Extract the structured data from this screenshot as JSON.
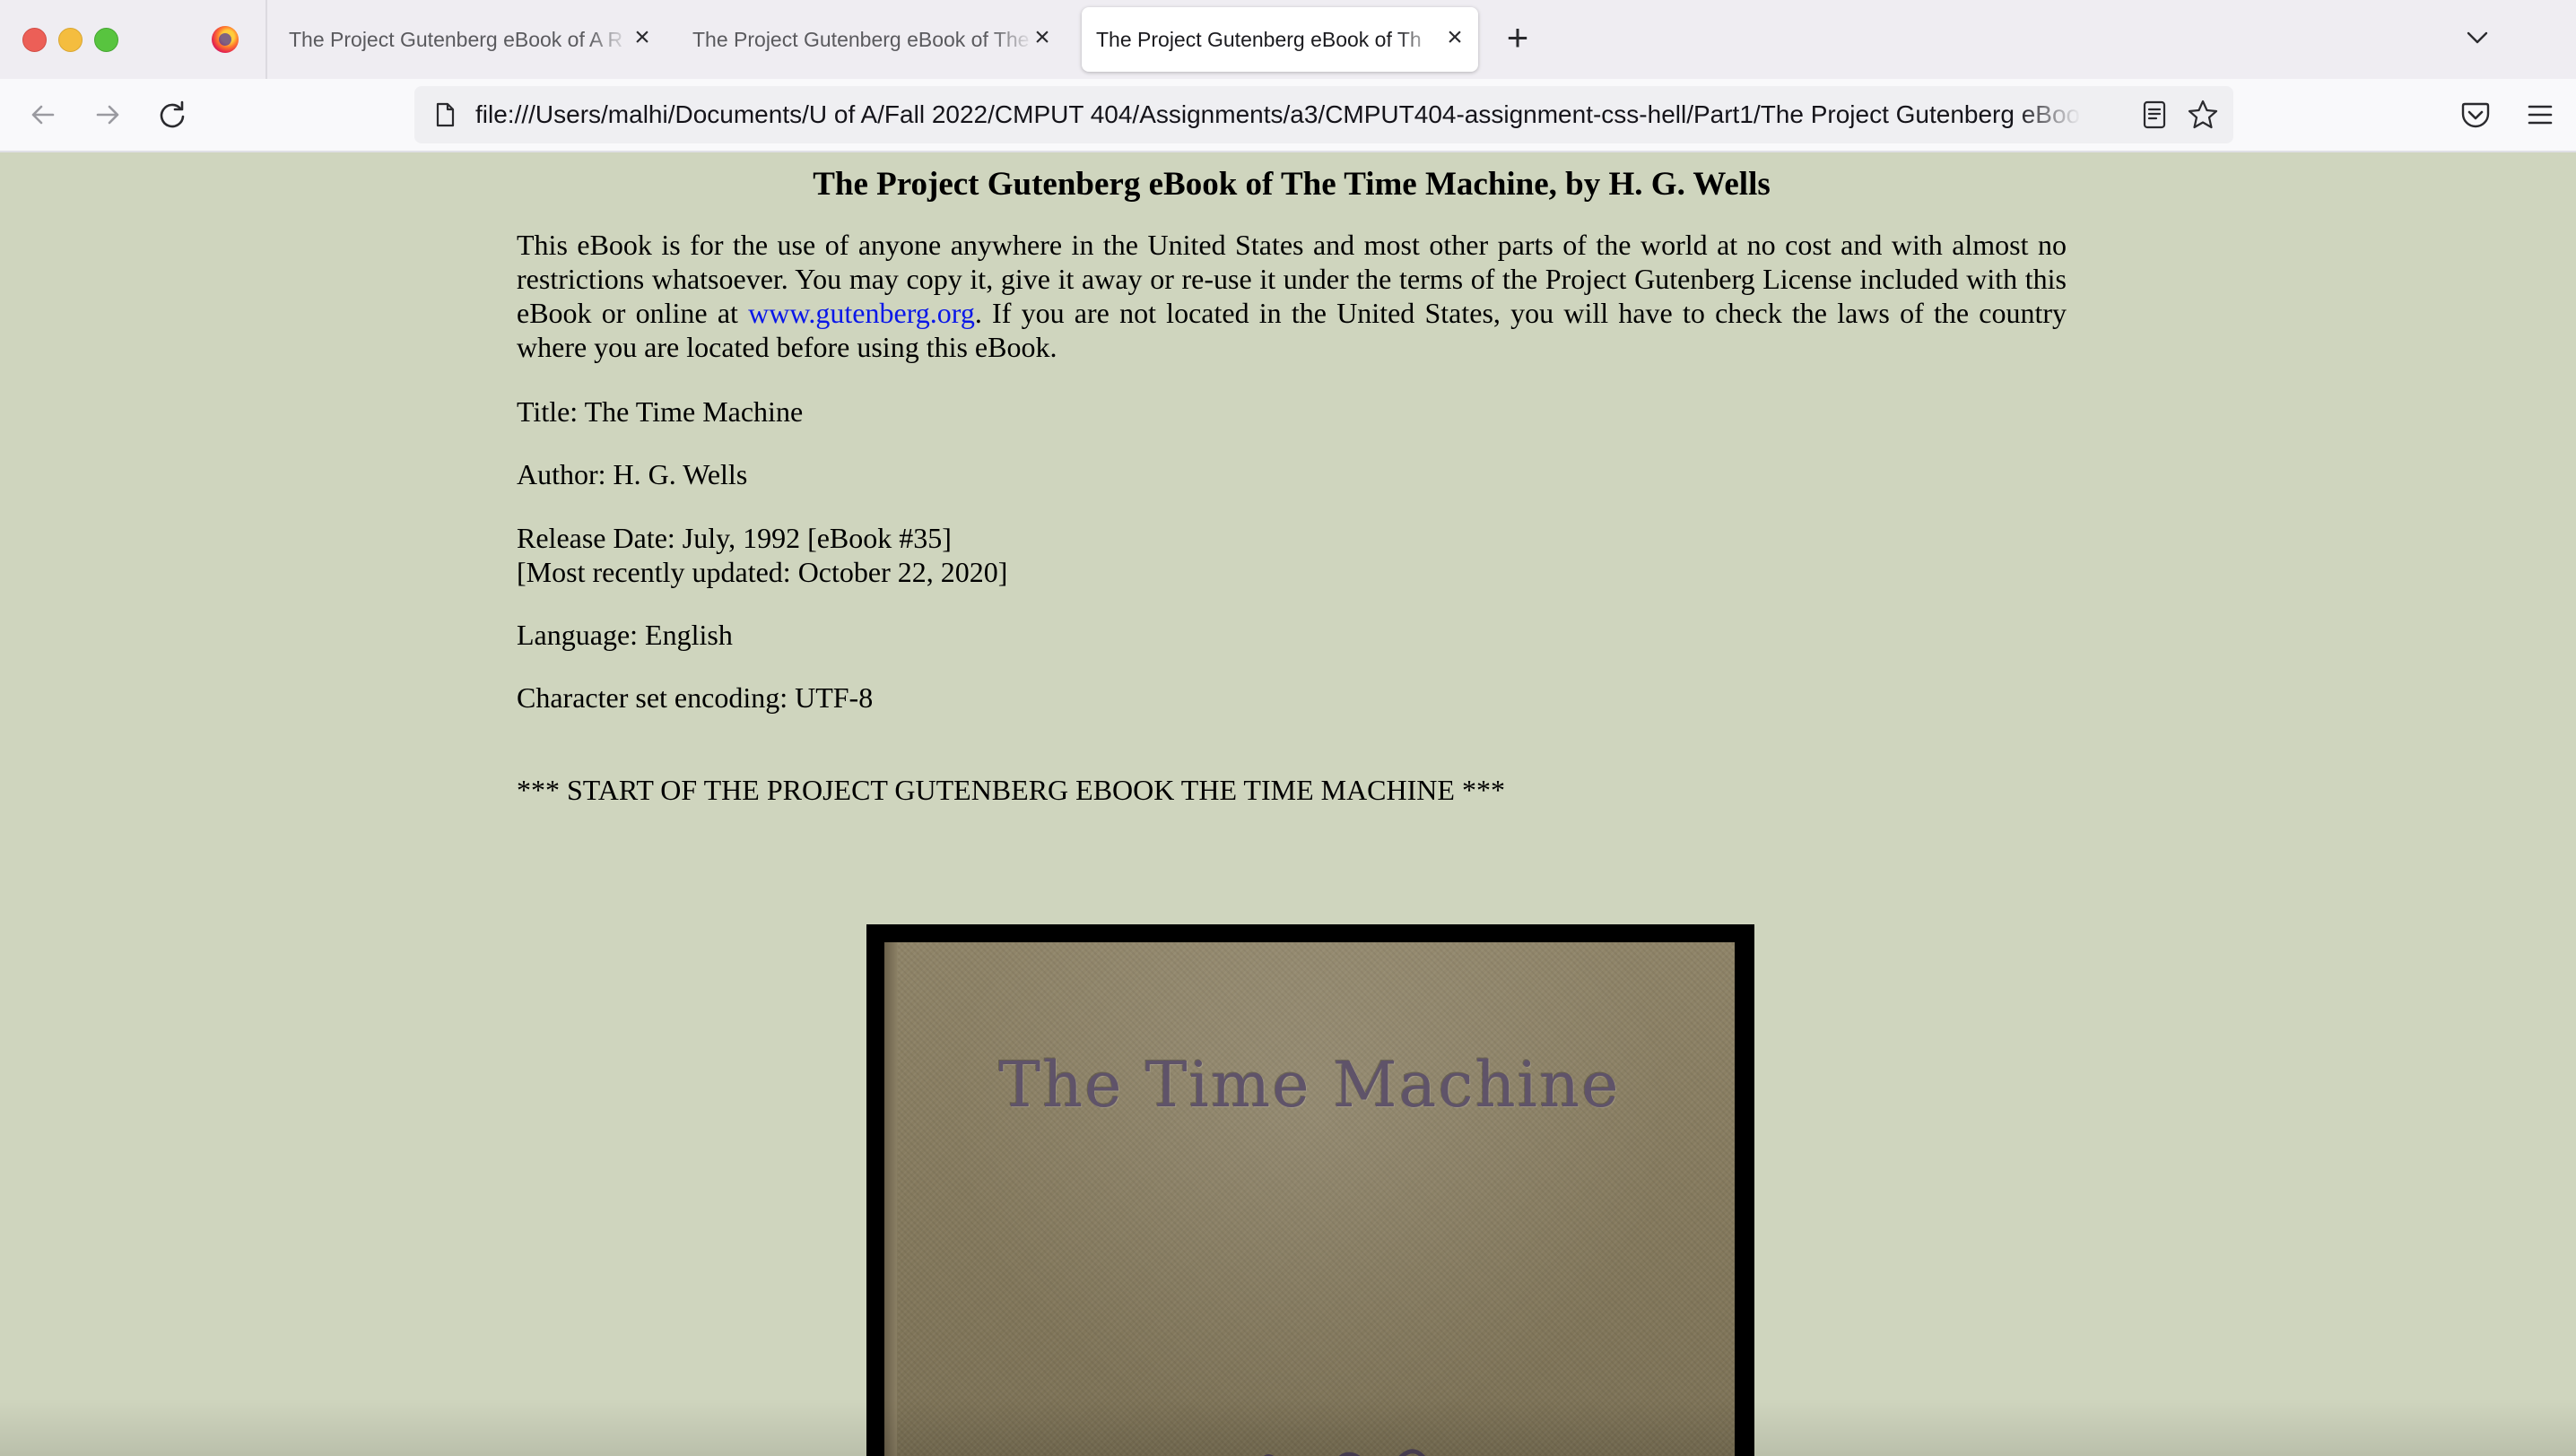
{
  "window": {
    "controls": {
      "close_color": "#ec5f57",
      "minimize_color": "#f4bd3f",
      "zoom_color": "#58c43f"
    }
  },
  "tabs": [
    {
      "title": "The Project Gutenberg eBook of A R",
      "active": false
    },
    {
      "title": "The Project Gutenberg eBook of The",
      "active": false
    },
    {
      "title": "The Project Gutenberg eBook of Th",
      "active": true
    }
  ],
  "icons": {
    "browser": "firefox-icon",
    "tab_close": "close-icon",
    "new_tab": "plus-icon",
    "tab_list": "chevron-down-icon",
    "back": "arrow-left-icon",
    "forward": "arrow-right-icon",
    "reload": "reload-icon",
    "page": "page-icon",
    "reader": "reader-view-icon",
    "bookmark": "star-icon",
    "pocket": "pocket-icon",
    "menu": "hamburger-menu-icon"
  },
  "toolbar": {
    "url": "file:///Users/malhi/Documents/U of A/Fall 2022/CMPUT 404/Assignments/a3/CMPUT404-assignment-css-hell/Part1/The Project Gutenberg eBook"
  },
  "page": {
    "background": "#cfd5be",
    "heading": "The Project Gutenberg eBook of The Time Machine, by H. G. Wells",
    "intro_before_link": "This eBook is for the use of anyone anywhere in the United States and most other parts of the world at no cost and with almost no restrictions whatsoever. You may copy it, give it away or re-use it under the terms of the Project Gutenberg License included with this eBook or online at ",
    "intro_link": "www.gutenberg.org",
    "intro_link_color": "#0a17e8",
    "intro_after_link": ". If you are not located in the United States, you will have to check the laws of the country where you are located before using this eBook.",
    "title_line": "Title: The Time Machine",
    "author_line": "Author: H. G. Wells",
    "release_line": "Release Date: July, 1992 [eBook #35]",
    "updated_line": "[Most recently updated: October 22, 2020]",
    "language_line": "Language: English",
    "charset_line": "Character set encoding: UTF-8",
    "start_line": "*** START OF THE PROJECT GUTENBERG EBOOK THE TIME MACHINE ***",
    "cover_text": "The Time Machine"
  }
}
